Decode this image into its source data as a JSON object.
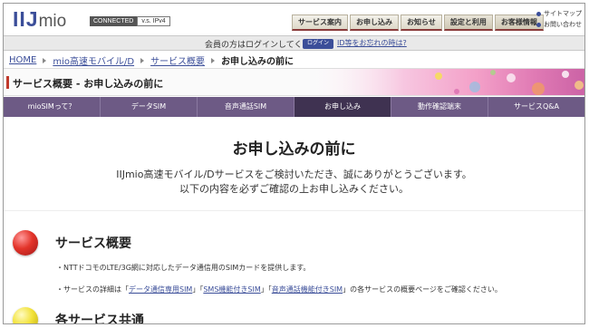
{
  "header": {
    "logo_main": "IIJ",
    "logo_sub": "mio",
    "connected_label": "CONNECTED",
    "ipv_label": "v.s. IPv4",
    "global_tabs": [
      "サービス案内",
      "お申し込み",
      "お知らせ",
      "設定と利用",
      "お客様情報"
    ],
    "util_links": [
      "サイトマップ",
      "お問い合わせ"
    ]
  },
  "login": {
    "message": "会員の方はログインしてください。",
    "button": "ログイン",
    "forgot": "ID等をお忘れの時は?"
  },
  "breadcrumb": [
    "HOME",
    "mio高速モバイル/D",
    "サービス概要",
    "お申し込みの前に"
  ],
  "page_heading": "サービス概要 - お申し込みの前に",
  "service_nav": [
    "mioSIMって？",
    "データSIM",
    "音声通話SIM",
    "お申し込み",
    "動作確認端末",
    "サービスQ&A"
  ],
  "active_nav_index": 3,
  "main": {
    "title": "お申し込みの前に",
    "lead_line1": "IIJmio高速モバイル/Dサービスをご検討いただき、誠にありがとうございます。",
    "lead_line2": "以下の内容を必ずご確認の上お申し込みください。"
  },
  "section1": {
    "title": "サービス概要",
    "bullet1": "・NTTドコモのLTE/3G網に対応したデータ通信用のSIMカードを提供します。",
    "bullet2_prefix": "・サービスの詳細は「",
    "link1": "データ通信専用SIM",
    "sep1": "」「",
    "link2": "SMS機能付きSIM",
    "sep2": "」「",
    "link3": "音声通話機能付きSIM",
    "bullet2_suffix": "」の各サービスの概要ページをご確認ください。"
  },
  "section2": {
    "title": "各サービス共通"
  },
  "colors": {
    "brand": "#3b4e99",
    "nav_bg": "#6d5a85",
    "nav_active": "#3f3251",
    "accent_red": "#c0392b"
  }
}
